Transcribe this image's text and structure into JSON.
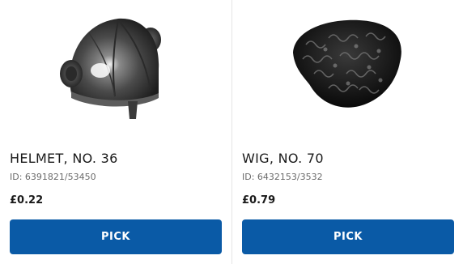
{
  "products": [
    {
      "name": "HELMET, NO. 36",
      "id_label": "ID: 6391821/53450",
      "price": "£0.22",
      "button_label": "PICK",
      "image": "helmet-image"
    },
    {
      "name": "WIG, NO. 70",
      "id_label": "ID: 6432153/3532",
      "price": "£0.79",
      "button_label": "PICK",
      "image": "wig-image"
    }
  ],
  "colors": {
    "button": "#0a5aa6",
    "divider": "#e4e4e4",
    "text": "#1a1a1a",
    "muted": "#6b6b6b"
  }
}
